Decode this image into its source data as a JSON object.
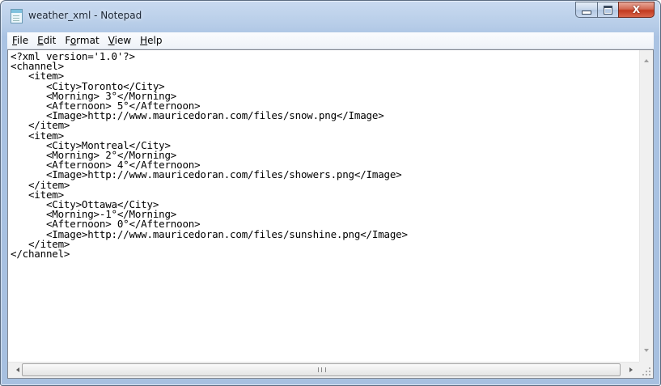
{
  "window": {
    "title": "weather_xml - Notepad",
    "close_label": "X"
  },
  "menu": {
    "items": [
      {
        "accel": "F",
        "rest": "ile"
      },
      {
        "accel": "E",
        "rest": "dit"
      },
      {
        "accel": "o",
        "pre": "F",
        "rest": "rmat"
      },
      {
        "accel": "V",
        "rest": "iew"
      },
      {
        "accel": "H",
        "rest": "elp"
      }
    ]
  },
  "document": {
    "lines": [
      "<?xml version='1.0'?>",
      "<channel>",
      "   <item>",
      "      <City>Toronto</City>",
      "      <Morning> 3°</Morning>",
      "      <Afternoon> 5°</Afternoon>",
      "      <Image>http://www.mauricedoran.com/files/snow.png</Image>",
      "   </item>",
      "   <item>",
      "      <City>Montreal</City>",
      "      <Morning> 2°</Morning>",
      "      <Afternoon> 4°</Afternoon>",
      "      <Image>http://www.mauricedoran.com/files/showers.png</Image>",
      "   </item>",
      "   <item>",
      "      <City>Ottawa</City>",
      "      <Morning>-1°</Morning>",
      "      <Afternoon> 0°</Afternoon>",
      "      <Image>http://www.mauricedoran.com/files/sunshine.png</Image>",
      "   </item>",
      "</channel>"
    ]
  },
  "colors": {
    "title_bar": "#b7cde8",
    "close_button": "#c2391f",
    "text": "#000000"
  },
  "icons": {
    "app": "notepad-icon",
    "minimize": "minimize-icon",
    "maximize": "maximize-icon",
    "close": "close-icon"
  }
}
